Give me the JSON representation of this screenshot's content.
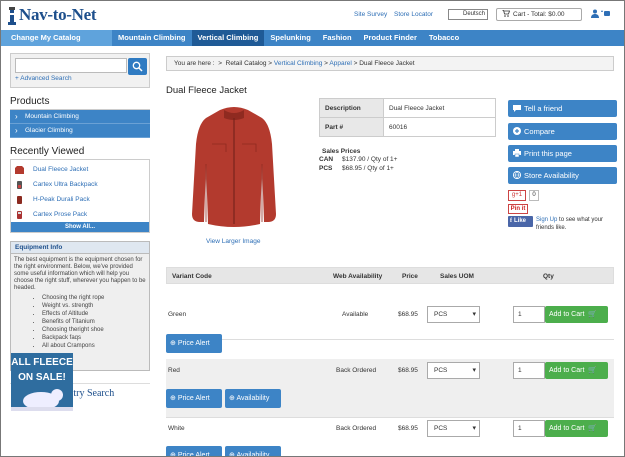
{
  "header": {
    "logo_text": "Nav-to-Net",
    "site_survey": "Site Survey",
    "store_locator": "Store Locator",
    "language": "Deutsch",
    "cart": "Cart - Total: $0.00"
  },
  "nav": {
    "items": [
      "Change My Catalog",
      "Mountain Climbing",
      "Vertical Climbing",
      "Spelunking",
      "Fashion",
      "Product Finder",
      "Tobacco"
    ]
  },
  "search": {
    "placeholder": "",
    "advanced": "+ Advanced Search"
  },
  "products": {
    "title": "Products",
    "items": [
      "Mountain Climbing",
      "Glacier Climbing"
    ]
  },
  "recently_viewed": {
    "title": "Recently Viewed",
    "items": [
      "Dual Fleece Jacket",
      "Cartex Ultra Backpack",
      "H-Peak Durali Pack",
      "Cartex Prose Pack"
    ],
    "show_all": "Show All..."
  },
  "equipment_info": {
    "title": "Equipment Info",
    "body": "The best equipment is the equipment chosen for the right environment. Below, we've provided some useful information which will help you choose the right stuff, wherever you happen to be headed.",
    "items": [
      "Choosing the right rope",
      "Weight vs. strength",
      "Effects of Altitude",
      "Benefits of Titanium",
      "Choosing theright shoe",
      "Backpack faqs",
      "All about Crampons"
    ]
  },
  "gift_registry": "Gift Registry Search",
  "promo": {
    "line1": "ALL FLEECE",
    "line2": "ON SALE!"
  },
  "breadcrumb": {
    "prefix": "You are here :",
    "items": [
      "Retail Catalog",
      "Vertical Climbing",
      "Apparel",
      "Dual Fleece Jacket"
    ],
    "sep": ">"
  },
  "product": {
    "title": "Dual Fleece Jacket",
    "view_larger": "View Larger Image",
    "desc_label": "Description",
    "desc_value": "Dual Fleece Jacket",
    "part_label": "Part #",
    "part_value": "60016",
    "sales_title": "Sales Prices",
    "prices": [
      {
        "currency": "CAN",
        "price": "$137.90 / Qty of 1+"
      },
      {
        "currency": "PCS",
        "price": "$68.95 / Qty of 1+"
      }
    ]
  },
  "actions": {
    "tell_friend": "Tell a friend",
    "compare": "Compare",
    "print": "Print this page",
    "store_avail": "Store Availability",
    "gplus": "g+1",
    "gplus_count": "0",
    "pin": "Pin it",
    "fb_like": "Like",
    "fb_signup": "Sign Up",
    "fb_text": " to see what your friends like."
  },
  "variants": {
    "headers": [
      "Variant Code",
      "Web Availability",
      "Price",
      "Sales UOM",
      "Qty"
    ],
    "add_to_cart": "Add to Cart",
    "price_alert": "Price Alert",
    "availability": "Availability",
    "rows": [
      {
        "code": "Green",
        "availability": "Available",
        "price": "$68.95",
        "uom": "PCS",
        "qty": "1"
      },
      {
        "code": "Red",
        "availability": "Back Ordered",
        "price": "$68.95",
        "uom": "PCS",
        "qty": "1"
      },
      {
        "code": "White",
        "availability": "Back Ordered",
        "price": "$68.95",
        "uom": "PCS",
        "qty": "1"
      }
    ]
  },
  "colors": {
    "nav": "#3d84c6",
    "nav_active": "#1f5a96",
    "add_cart": "#4cae4c",
    "jacket": "#b33a2e"
  }
}
